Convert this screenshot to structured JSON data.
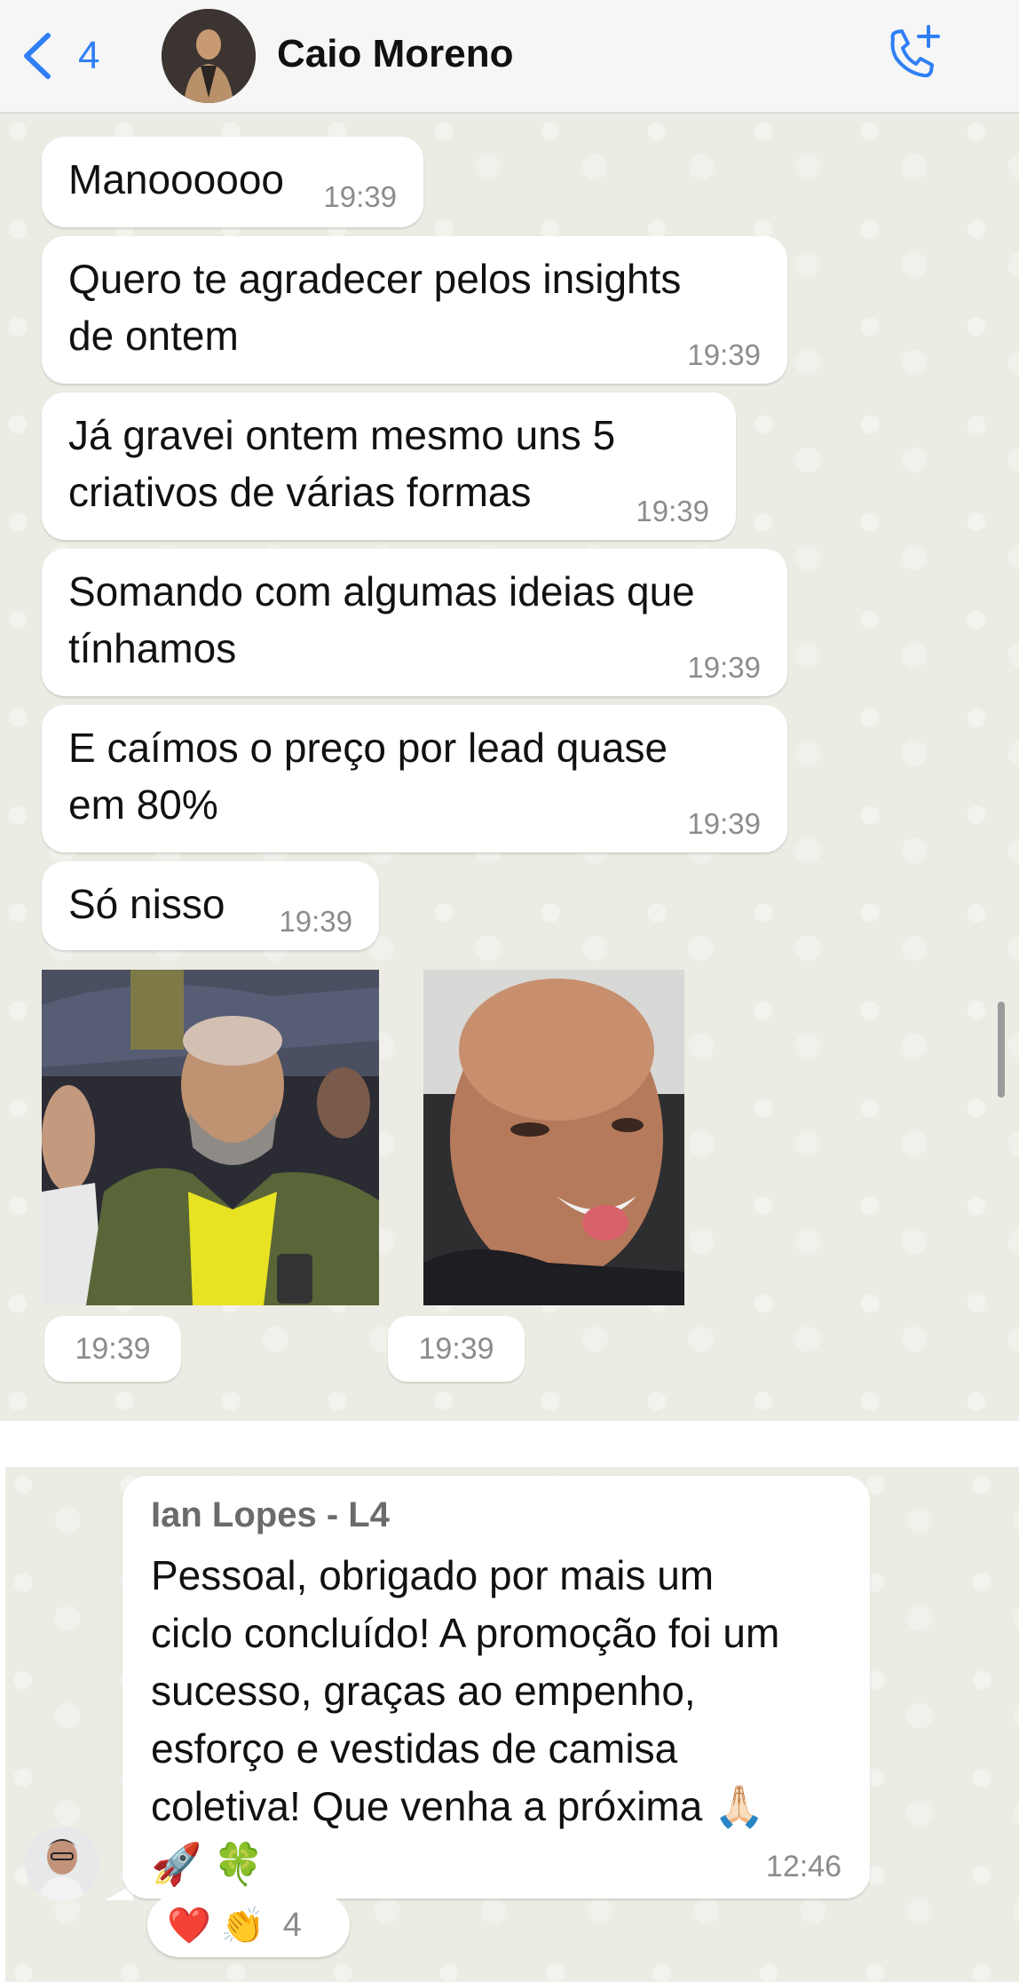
{
  "header": {
    "back_count": "4",
    "contact_name": "Caio Moreno"
  },
  "chat1": {
    "messages": [
      {
        "text": "Manoooooo",
        "time": "19:39"
      },
      {
        "text": "Quero te agradecer pelos insights\nde ontem",
        "time": "19:39"
      },
      {
        "text": "Já gravei ontem mesmo uns 5\ncriativos de várias formas",
        "time": "19:39"
      },
      {
        "text": "Somando com algumas ideias que\ntínhamos",
        "time": "19:39"
      },
      {
        "text": "E caímos o preço por lead quase\nem 80%",
        "time": "19:39"
      },
      {
        "text": "Só nisso",
        "time": "19:39"
      }
    ],
    "photos": [
      {
        "time": "19:39"
      },
      {
        "time": "19:39"
      }
    ]
  },
  "chat2": {
    "sender": "Ian Lopes - L4",
    "lines": [
      "Pessoal, obrigado por mais um",
      "ciclo concluído! A promoção foi um",
      "sucesso, graças ao empenho,",
      "esforço e vestidas de camisa",
      "coletiva! Que venha a próxima 🙏🏻",
      "🚀 🍀"
    ],
    "time": "12:46",
    "reactions": {
      "emojis": "❤️ 👏",
      "count": "4"
    }
  },
  "colors": {
    "accent": "#2f7ff6",
    "chat_background": "#ecebe4",
    "bubble": "#ffffff",
    "timestamp": "#8c8c8c"
  },
  "icons": [
    "chevron-left-icon",
    "phone-plus-icon"
  ]
}
